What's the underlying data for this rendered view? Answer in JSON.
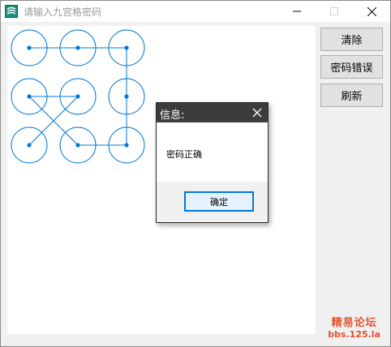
{
  "window": {
    "title": "请输入九宫格密码"
  },
  "buttons": {
    "clear": "清除",
    "wrong_password": "密码错误",
    "refresh": "刷新"
  },
  "pattern": {
    "nodes": 9,
    "line_color": "#0078d7",
    "path": [
      [
        0,
        0
      ],
      [
        1,
        0
      ],
      [
        2,
        0
      ],
      [
        2,
        1
      ],
      [
        2,
        2
      ],
      [
        1,
        2
      ],
      [
        0,
        1
      ],
      [
        1,
        1
      ],
      [
        0,
        2
      ]
    ]
  },
  "dialog": {
    "title": "信息:",
    "message": "密码正确",
    "ok": "确定"
  },
  "watermark": {
    "line1": "精易论坛",
    "line2": "bbs.125.la"
  },
  "colors": {
    "accent": "#0078d7",
    "watermark": "#e2532f",
    "dialog_title_bg": "#3c3c3c"
  }
}
